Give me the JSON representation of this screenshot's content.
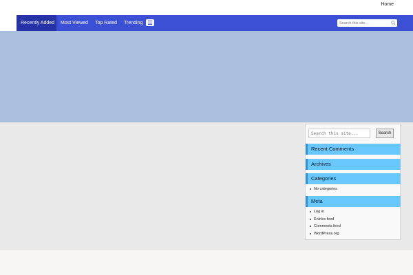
{
  "topbar": {
    "home_label": "Home"
  },
  "nav": {
    "items": [
      {
        "label": "Recently Added",
        "active": true
      },
      {
        "label": "Most Viewed"
      },
      {
        "label": "Top Rated"
      },
      {
        "label": "Trending"
      }
    ],
    "search_placeholder": "Search this site..."
  },
  "sidebar": {
    "search_placeholder": "Search this site...",
    "search_button": "Search",
    "widgets": {
      "recent_comments": {
        "title": "Recent Comments"
      },
      "archives": {
        "title": "Archives"
      },
      "categories": {
        "title": "Categories",
        "items": [
          "No categories"
        ]
      },
      "meta": {
        "title": "Meta",
        "items": [
          "Log in",
          "Entries feed",
          "Comments feed",
          "WordPress.org"
        ]
      }
    }
  },
  "colors": {
    "nav_bg": "#3c50d6",
    "nav_active": "#2633a6",
    "hero_bg": "#aabfdd",
    "widget_title_bg": "#68c8fb",
    "widget_title_border": "#3a91c9"
  }
}
